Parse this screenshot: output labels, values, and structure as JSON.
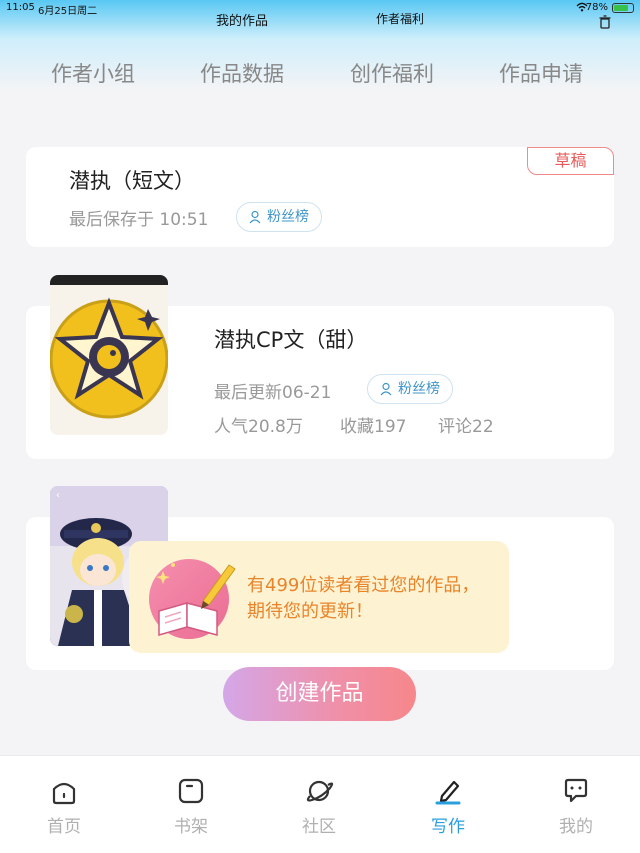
{
  "status_bar": {
    "time": "11:05",
    "date": "6月25日周二",
    "battery": "78%",
    "battery_level": 0.78
  },
  "nav": {
    "my_works": "我的作品",
    "author_benefits": "作者福利"
  },
  "tabs": [
    "作者小组",
    "作品数据",
    "创作福利",
    "作品申请"
  ],
  "works": [
    {
      "title": "潜执（短文）",
      "tag": "草稿",
      "meta": "最后保存于 10:51",
      "fans": "粉丝榜"
    },
    {
      "title": "潜执CP文（甜）",
      "meta": "最后更新06-21",
      "fans": "粉丝榜",
      "popularity": "人气20.8万",
      "favorites": "收藏197",
      "comments": "评论22"
    }
  ],
  "toast": {
    "text": "有499位读者看过您的作品，期待您的更新！"
  },
  "create_button": "创建作品",
  "bottom_nav": [
    {
      "label": "首页",
      "icon": "home-icon"
    },
    {
      "label": "书架",
      "icon": "bookshelf-icon"
    },
    {
      "label": "社区",
      "icon": "planet-icon"
    },
    {
      "label": "写作",
      "icon": "pen-icon",
      "active": true
    },
    {
      "label": "我的",
      "icon": "chat-bubble-icon"
    }
  ],
  "colors": {
    "accent": "#2a9fde",
    "draft": "#e85b5b",
    "toast_text": "#e8842a"
  }
}
